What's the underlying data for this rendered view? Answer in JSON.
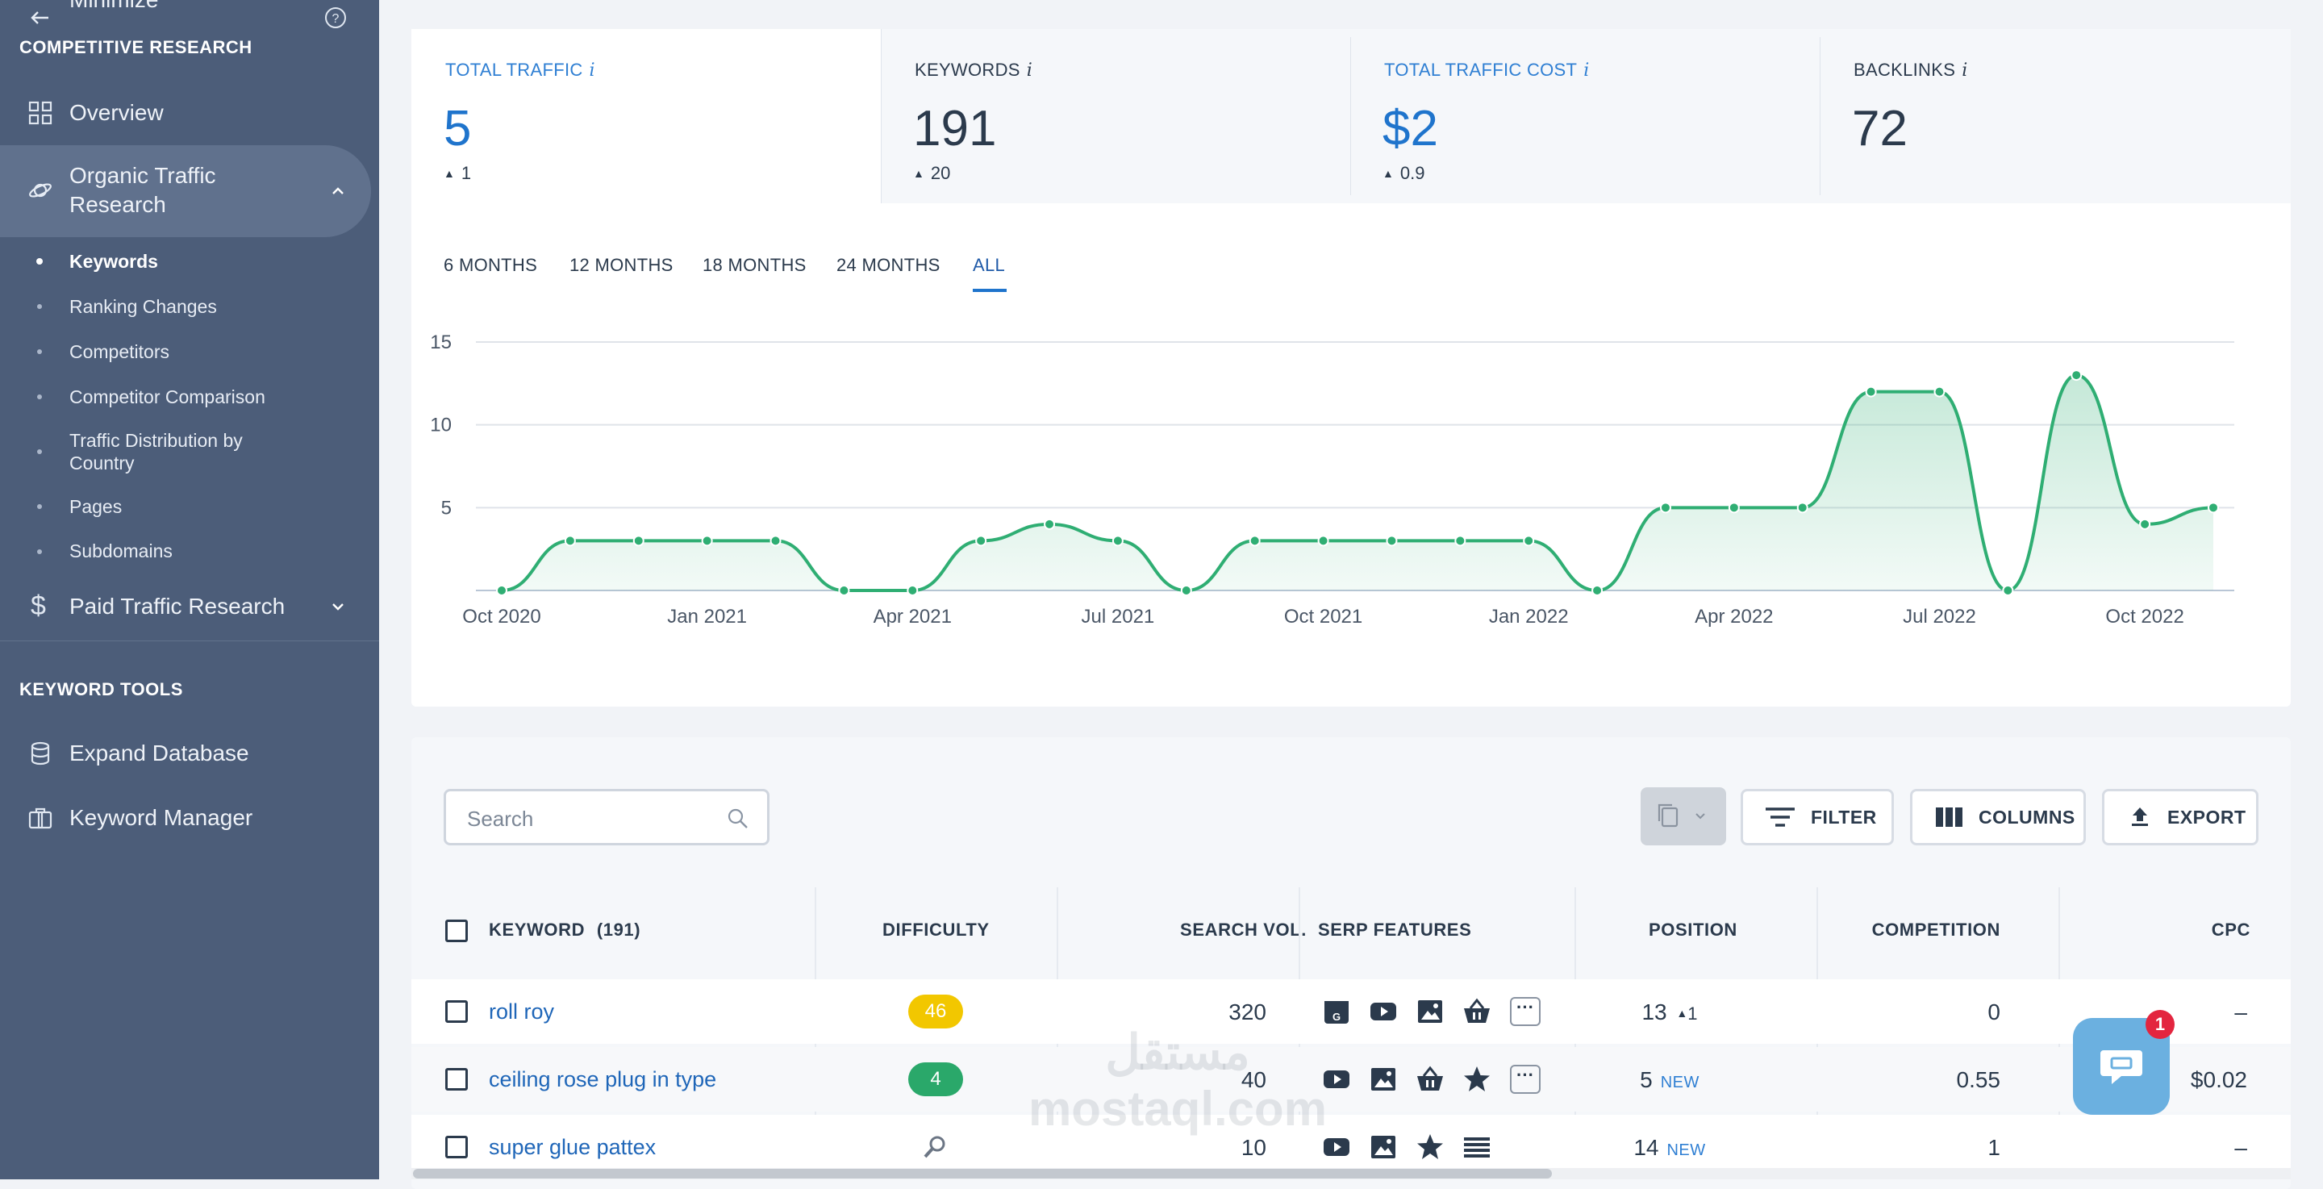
{
  "sidebar": {
    "section1": "COMPETITIVE RESEARCH",
    "overview": "Overview",
    "organic": "Organic Traffic Research",
    "sub": [
      "Keywords",
      "Ranking Changes",
      "Competitors",
      "Competitor Comparison",
      "Traffic Distribution by Country",
      "Pages",
      "Subdomains"
    ],
    "paid": "Paid Traffic Research",
    "section2": "KEYWORD TOOLS",
    "expand": "Expand Database",
    "manager": "Keyword Manager",
    "minimize": "Minimize"
  },
  "metrics": [
    {
      "title": "TOTAL TRAFFIC",
      "value": "5",
      "delta": "1"
    },
    {
      "title": "KEYWORDS",
      "value": "191",
      "delta": "20"
    },
    {
      "title": "TOTAL TRAFFIC COST",
      "value": "$2",
      "delta": "0.9"
    },
    {
      "title": "BACKLINKS",
      "value": "72",
      "delta": ""
    }
  ],
  "ranges": [
    "6 MONTHS",
    "12 MONTHS",
    "18 MONTHS",
    "24 MONTHS",
    "ALL"
  ],
  "chart_data": {
    "type": "area",
    "x": [
      "Oct 2020",
      "Nov 2020",
      "Dec 2020",
      "Jan 2021",
      "Feb 2021",
      "Mar 2021",
      "Apr 2021",
      "May 2021",
      "Jun 2021",
      "Jul 2021",
      "Aug 2021",
      "Sep 2021",
      "Oct 2021",
      "Nov 2021",
      "Dec 2021",
      "Jan 2022",
      "Feb 2022",
      "Mar 2022",
      "Apr 2022",
      "May 2022",
      "Jun 2022",
      "Jul 2022",
      "Aug 2022",
      "Sep 2022",
      "Oct 2022",
      "Nov 2022"
    ],
    "values": [
      0,
      3,
      3,
      3,
      3,
      0,
      0,
      3,
      4,
      3,
      0,
      3,
      3,
      3,
      3,
      3,
      0,
      5,
      5,
      5,
      12,
      12,
      0,
      13,
      4,
      5
    ],
    "xticks": [
      "Oct 2020",
      "Jan 2021",
      "Apr 2021",
      "Jul 2021",
      "Oct 2021",
      "Jan 2022",
      "Apr 2022",
      "Jul 2022",
      "Oct 2022"
    ],
    "yticks": [
      "5",
      "10",
      "15"
    ],
    "ylim": [
      0,
      15
    ],
    "color": "#2fae73"
  },
  "toolbar": {
    "search_placeholder": "Search",
    "filter": "FILTER",
    "columns": "COLUMNS",
    "export": "EXPORT"
  },
  "table": {
    "headers": [
      "KEYWORD",
      "(191)",
      "DIFFICULTY",
      "SEARCH VOL.",
      "SERP FEATURES",
      "POSITION",
      "COMPETITION",
      "CPC"
    ],
    "rows": [
      {
        "keyword": "roll roy",
        "difficulty": "46",
        "vol": "320",
        "position": "13",
        "pos_delta": "1",
        "pos_new": "",
        "competition": "0",
        "cpc": "–"
      },
      {
        "keyword": "ceiling rose plug in type",
        "difficulty": "4",
        "vol": "40",
        "position": "5",
        "pos_delta": "",
        "pos_new": "NEW",
        "competition": "0.55",
        "cpc": "$0.02"
      },
      {
        "keyword": "super glue pattex",
        "difficulty": "",
        "vol": "10",
        "position": "14",
        "pos_delta": "",
        "pos_new": "NEW",
        "competition": "1",
        "cpc": "–"
      }
    ]
  },
  "chat_badge": "1",
  "watermark": "مستقل mostaql.com"
}
